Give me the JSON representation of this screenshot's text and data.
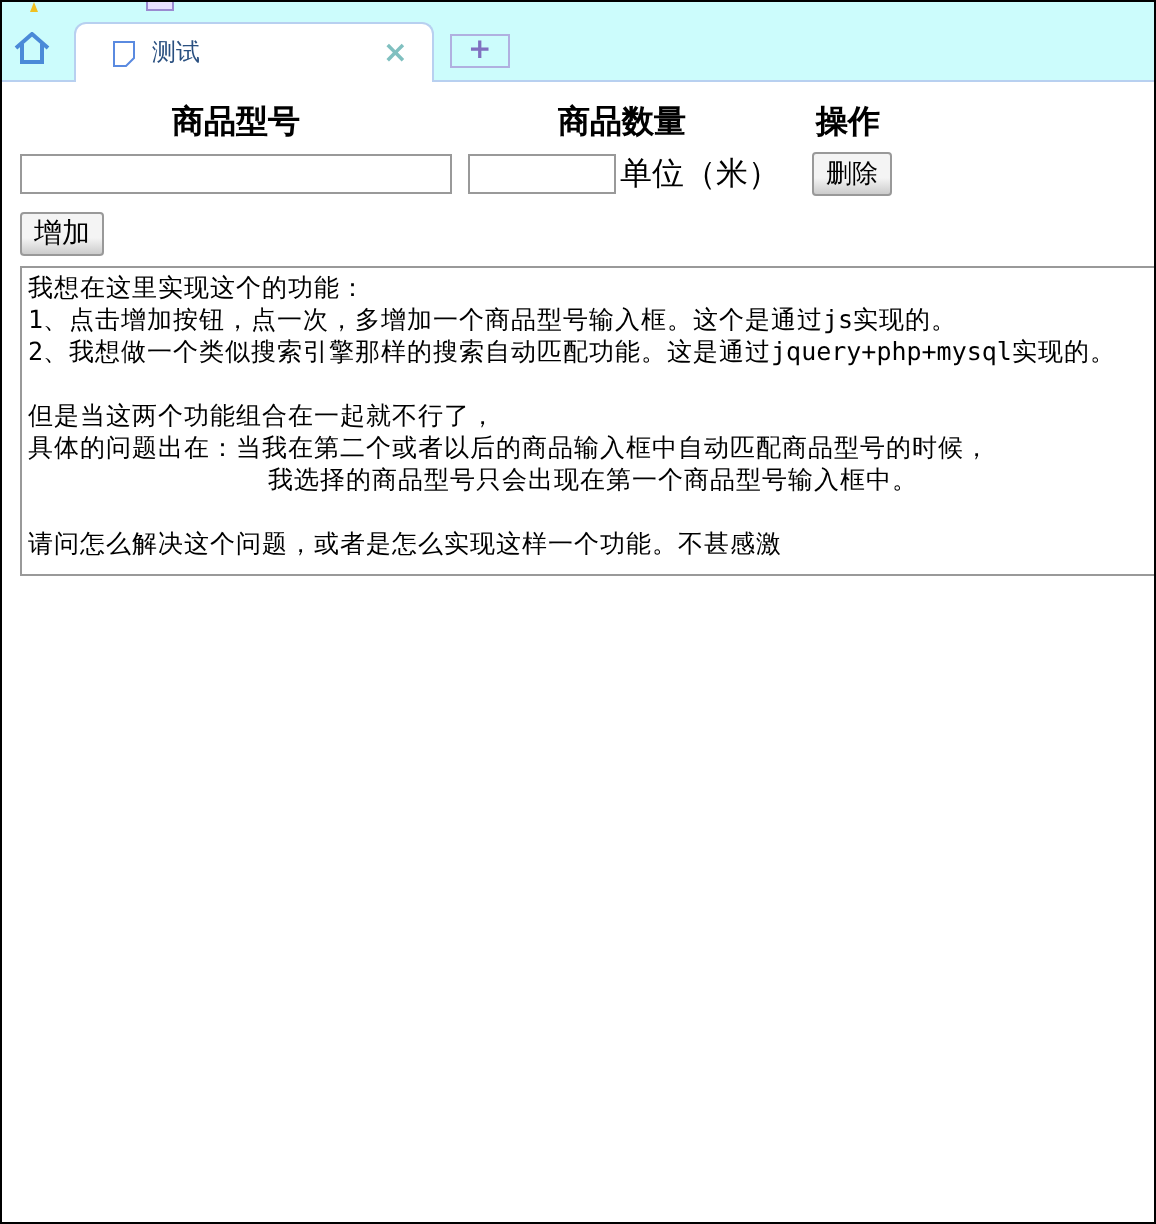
{
  "browser": {
    "tabs": [
      {
        "title": "测试",
        "selected": true
      }
    ],
    "close": "×",
    "new_tab": "+"
  },
  "form": {
    "headers": [
      "商品型号",
      "商品数量",
      "操作"
    ],
    "rows": [
      {
        "unit": "单位（米）",
        "delete": "删除"
      }
    ],
    "add_button": "增加"
  },
  "message": {
    "paragraphs": [
      [
        {
          "text": "我想在这里实现这个的功能：",
          "indented": false
        },
        {
          "text": "1、点击增加按钮，点一次，多增加一个商品型号输入框。这个是通过js实现的。",
          "indented": false
        },
        {
          "text": "2、我想做一个类似搜索引擎那样的搜索自动匹配功能。这是通过jquery+php+mysql实现的。",
          "indented": false
        }
      ],
      [
        {
          "text": "但是当这两个功能组合在一起就不行了，",
          "indented": false
        },
        {
          "text": "具体的问题出在：当我在第二个或者以后的商品输入框中自动匹配商品型号的时候，",
          "indented": false
        },
        {
          "text": "我选择的商品型号只会出现在第一个商品型号输入框中。",
          "indented": true
        }
      ],
      [
        {
          "text": "请问怎么解决这个问题，或者是怎么实现这样一个功能。不甚感激",
          "indented": false
        }
      ]
    ]
  }
}
